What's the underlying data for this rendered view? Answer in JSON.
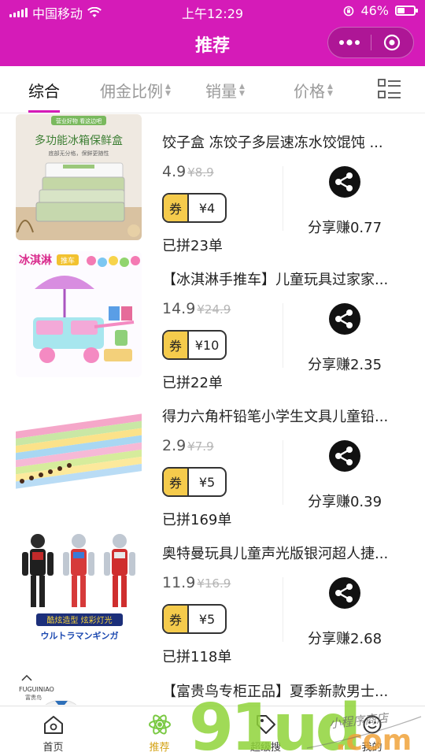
{
  "status_bar": {
    "carrier": "中国移动",
    "time": "上午12:29",
    "battery": "46%",
    "battery_level": 0.46
  },
  "header": {
    "title": "推荐",
    "more_icon": "more-dots-icon",
    "close_icon": "target-circle-icon"
  },
  "tabs": [
    {
      "label": "综合"
    },
    {
      "label": "佣金比例"
    },
    {
      "label": "销量"
    },
    {
      "label": "价格"
    }
  ],
  "products": [
    {
      "name": "饺子盒 冻饺子多层速冻水饺馄饨 ...",
      "price": "4.9",
      "original": "8.9",
      "coupon_tag": "券",
      "coupon": "¥4",
      "sold": "已拼23单",
      "share": "分享赚0.77",
      "thumb_text_top": "营业好物 看这边吧",
      "thumb_text_main": "多功能冰箱保鲜盒",
      "thumb_text_sub": "底部无分格，保鲜更随性"
    },
    {
      "name": "【冰淇淋手推车】儿童玩具过家家...",
      "price": "14.9",
      "original": "24.9",
      "coupon_tag": "券",
      "coupon": "¥10",
      "sold": "已拼22单",
      "share": "分享赚2.35",
      "thumb_text_main": "冰淇淋",
      "thumb_text_sub": "推车"
    },
    {
      "name": "得力六角杆铅笔小学生文具儿童铅...",
      "price": "2.9",
      "original": "7.9",
      "coupon_tag": "券",
      "coupon": "¥5",
      "sold": "已拼169单",
      "share": "分享赚0.39"
    },
    {
      "name": "奥特曼玩具儿童声光版银河超人捷...",
      "price": "11.9",
      "original": "16.9",
      "coupon_tag": "券",
      "coupon": "¥5",
      "sold": "已拼118单",
      "share": "分享赚2.68",
      "thumb_text_main": "酷炫造型 炫彩灯光",
      "thumb_text_sub": "ウルトラマンギンガ"
    }
  ],
  "partial_product": {
    "name": "【富贵鸟专柜正品】夏季新款男士...",
    "brand": "FUGUINIAO",
    "brand_cn": "富贵鸟"
  },
  "tabbar": [
    {
      "label": "首页",
      "icon": "home-icon"
    },
    {
      "label": "推荐",
      "icon": "atom-icon"
    },
    {
      "label": "超级搜",
      "icon": "tag-icon"
    },
    {
      "label": "我的",
      "icon": "smiley-icon"
    }
  ],
  "watermark": {
    "big": "91ud",
    "dotcom": ".com",
    "tagline": "小程序商店"
  },
  "colors": {
    "brand": "#d51bb8",
    "coupon": "#f5cb4c",
    "active_tab": "#d4a316"
  }
}
